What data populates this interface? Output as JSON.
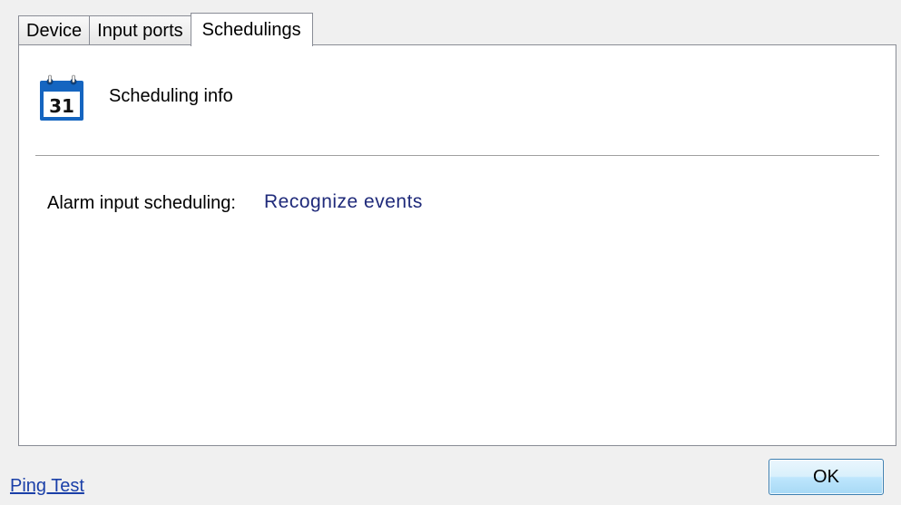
{
  "tabs": [
    {
      "label": "Device",
      "active": false
    },
    {
      "label": "Input ports",
      "active": false
    },
    {
      "label": "Schedulings",
      "active": true
    }
  ],
  "panel": {
    "icon": "calendar-icon",
    "calendar_day": "31",
    "section_title": "Scheduling info",
    "alarm_label": "Alarm input scheduling:",
    "alarm_value": "Recognize events"
  },
  "footer": {
    "ping_link": "Ping Test",
    "ok_label": "OK"
  },
  "colors": {
    "calendar_blue": "#1565c0",
    "value_text": "#1f2a7a",
    "link": "#1a3fa8",
    "button_border": "#3c7fb1"
  }
}
